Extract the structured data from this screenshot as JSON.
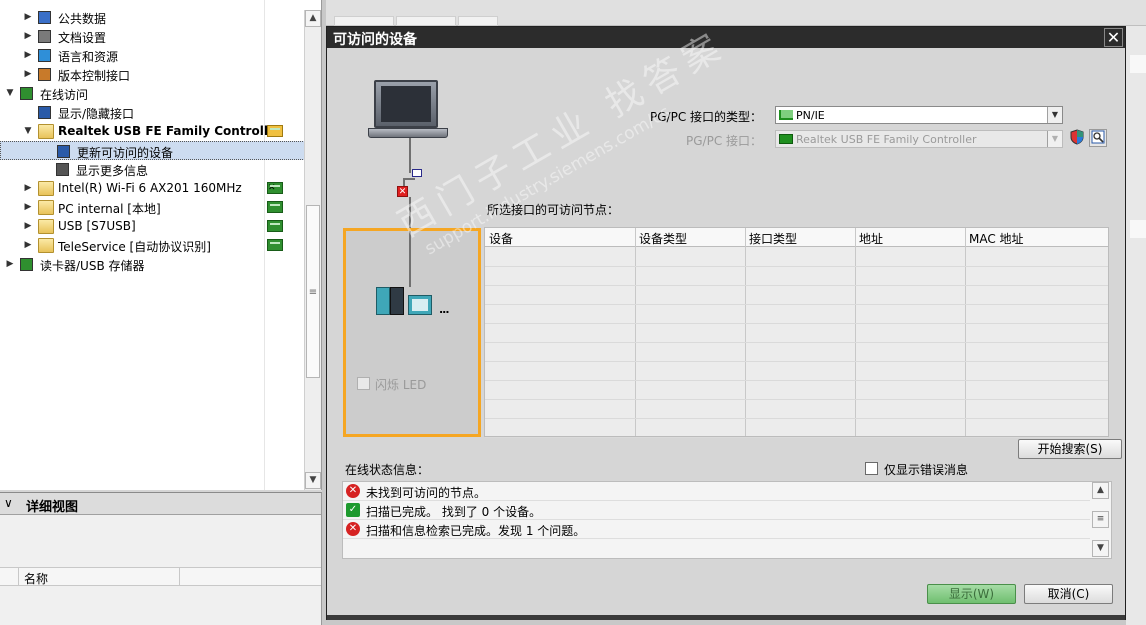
{
  "project_tree": {
    "items": [
      {
        "label": "公共数据",
        "icon": "common-data-icon",
        "indent": 2,
        "expander": "right"
      },
      {
        "label": "文档设置",
        "icon": "document-settings-icon",
        "indent": 2,
        "expander": "right"
      },
      {
        "label": "语言和资源",
        "icon": "language-icon",
        "indent": 2,
        "expander": "right"
      },
      {
        "label": "版本控制接口",
        "icon": "version-control-icon",
        "indent": 2,
        "expander": "right"
      },
      {
        "label": "在线访问",
        "icon": "online-access-icon",
        "indent": 1,
        "expander": "down"
      },
      {
        "label": "显示/隐藏接口",
        "icon": "wrench-icon",
        "indent": 2,
        "expander": ""
      },
      {
        "label": "Realtek USB FE Family Controller",
        "icon": "folder-icon",
        "indent": 2,
        "expander": "down",
        "bold": true,
        "status": "refresh-icon"
      },
      {
        "label": "更新可访问的设备",
        "icon": "update-devices-icon",
        "indent": 3,
        "expander": "",
        "selected": true
      },
      {
        "label": "显示更多信息",
        "icon": "info-icon",
        "indent": 3,
        "expander": ""
      },
      {
        "label": "Intel(R) Wi-Fi 6 AX201 160MHz",
        "icon": "folder-icon",
        "indent": 2,
        "expander": "right",
        "status": "network-card-disabled-icon"
      },
      {
        "label": "PC internal [本地]",
        "icon": "folder-icon",
        "indent": 2,
        "expander": "right",
        "status": "network-card-icon"
      },
      {
        "label": "USB [S7USB]",
        "icon": "folder-icon",
        "indent": 2,
        "expander": "right",
        "status": "network-card-icon"
      },
      {
        "label": "TeleService [自动协议识别]",
        "icon": "folder-icon",
        "indent": 2,
        "expander": "right",
        "status": "network-card-icon"
      },
      {
        "label": "读卡器/USB 存储器",
        "icon": "card-reader-icon",
        "indent": 1,
        "expander": "right"
      }
    ]
  },
  "details_view": {
    "title": "详细视图",
    "column_name": "名称"
  },
  "dialog": {
    "title": "可访问的设备",
    "pgpc_interface_type_label": "PG/PC 接口的类型：",
    "pgpc_interface_type_value": "PN/IE",
    "pgpc_interface_label": "PG/PC 接口：",
    "pgpc_interface_value": "Realtek USB FE Family Controller",
    "flash_led_label": "闪烁 LED",
    "nodes_caption": "所选接口的可访问节点：",
    "table_columns": [
      "设备",
      "设备类型",
      "接口类型",
      "地址",
      "MAC 地址"
    ],
    "table_rows": [],
    "start_search_button": "开始搜索(S)",
    "status_caption": "在线状态信息：",
    "show_errors_only_label": "仅显示错误消息",
    "status_messages": [
      {
        "type": "error",
        "text": "未找到可访问的节点。"
      },
      {
        "type": "ok",
        "text": "扫描已完成。 找到了 0 个设备。"
      },
      {
        "type": "error",
        "text": "扫描和信息检索已完成。发现 1 个问题。"
      }
    ],
    "display_button": "显示(W)",
    "cancel_button": "取消(C)",
    "watermark_line1": "西门子工业  找答案",
    "watermark_line2": "support.industry.siemens.com/cs"
  },
  "colors": {
    "device_box_border": "#f5a623",
    "title_bar": "#2c2c2c",
    "selection": "#cddcf0",
    "error": "#d62222",
    "ok": "#1e9a2e"
  }
}
